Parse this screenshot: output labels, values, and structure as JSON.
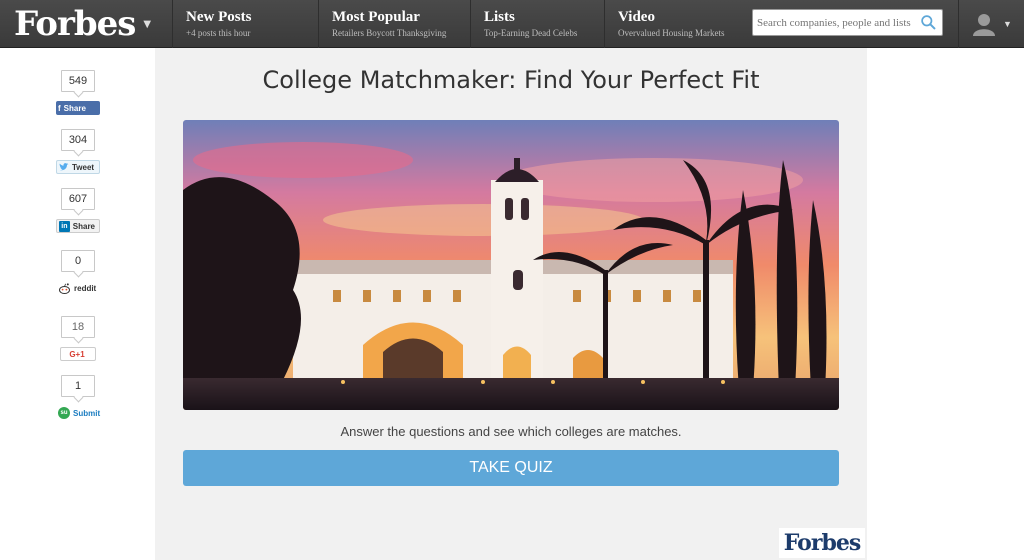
{
  "header": {
    "logo": "Forbes",
    "nav": [
      {
        "title": "New Posts",
        "sub": "+4 posts this hour"
      },
      {
        "title": "Most Popular",
        "sub": "Retailers Boycott Thanksgiving"
      },
      {
        "title": "Lists",
        "sub": "Top-Earning Dead Celebs"
      },
      {
        "title": "Video",
        "sub": "Overvalued Housing Markets"
      }
    ],
    "search": {
      "placeholder": "Search companies, people and lists"
    }
  },
  "share_rail": [
    {
      "count": "549",
      "label": "Share",
      "network": "facebook"
    },
    {
      "count": "304",
      "label": "Tweet",
      "network": "twitter"
    },
    {
      "count": "607",
      "label": "Share",
      "network": "linkedin"
    },
    {
      "count": "0",
      "label": "reddit",
      "network": "reddit"
    },
    {
      "count": "18",
      "label": "G+1",
      "network": "google-plus"
    },
    {
      "count": "1",
      "label": "Submit",
      "network": "stumbleupon"
    }
  ],
  "main": {
    "title": "College Matchmaker: Find Your Perfect Fit",
    "description": "Answer the questions and see which colleges are matches.",
    "cta": "TAKE QUIZ",
    "watermark": "Forbes"
  },
  "colors": {
    "topbar": "#404040",
    "cta": "#5ea7d8",
    "card": "#f1f1f1",
    "facebook": "#4a6ea9"
  }
}
